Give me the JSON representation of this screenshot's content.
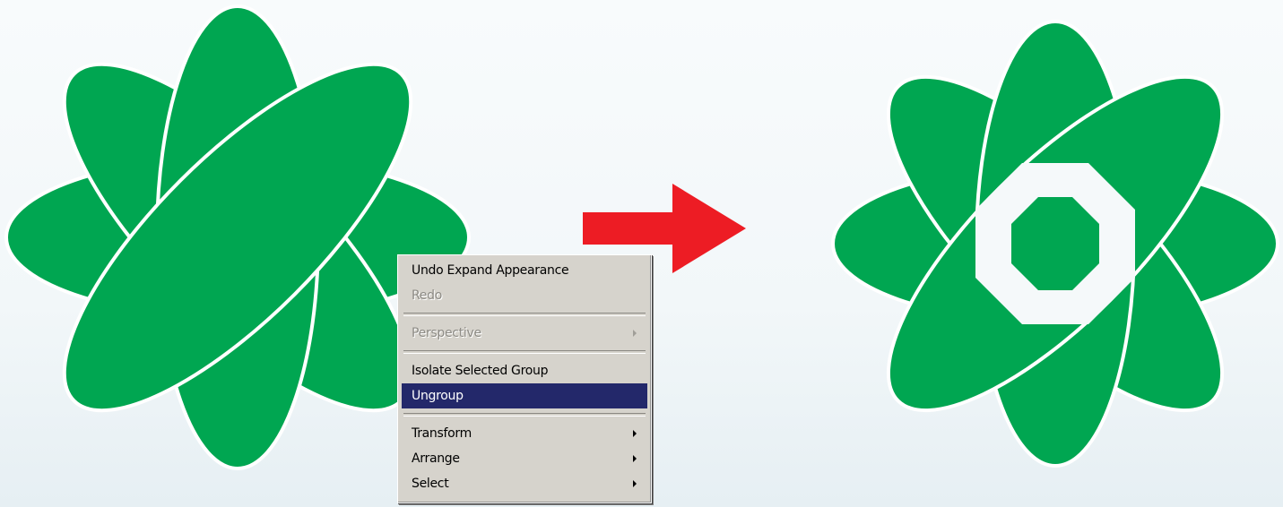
{
  "colors": {
    "art_green": "#00a651",
    "arrow_red": "#ed1c24",
    "menu_background": "#d6d3cc",
    "menu_highlight": "#23286a"
  },
  "illustration": {
    "before_icon": "atom-ellipse-flower-icon",
    "after_icon": "atom-ellipse-flower-ungrouped-icon",
    "arrow_icon": "arrow-right-icon"
  },
  "context_menu": {
    "items": [
      {
        "label": "Undo Expand Appearance",
        "enabled": true,
        "submenu": false
      },
      {
        "label": "Redo",
        "enabled": false,
        "submenu": false
      },
      {
        "label": "Perspective",
        "enabled": false,
        "submenu": true
      },
      {
        "label": "Isolate Selected Group",
        "enabled": true,
        "submenu": false
      },
      {
        "label": "Ungroup",
        "enabled": true,
        "submenu": false,
        "selected": true
      },
      {
        "label": "Transform",
        "enabled": true,
        "submenu": true
      },
      {
        "label": "Arrange",
        "enabled": true,
        "submenu": true
      },
      {
        "label": "Select",
        "enabled": true,
        "submenu": true
      }
    ]
  }
}
